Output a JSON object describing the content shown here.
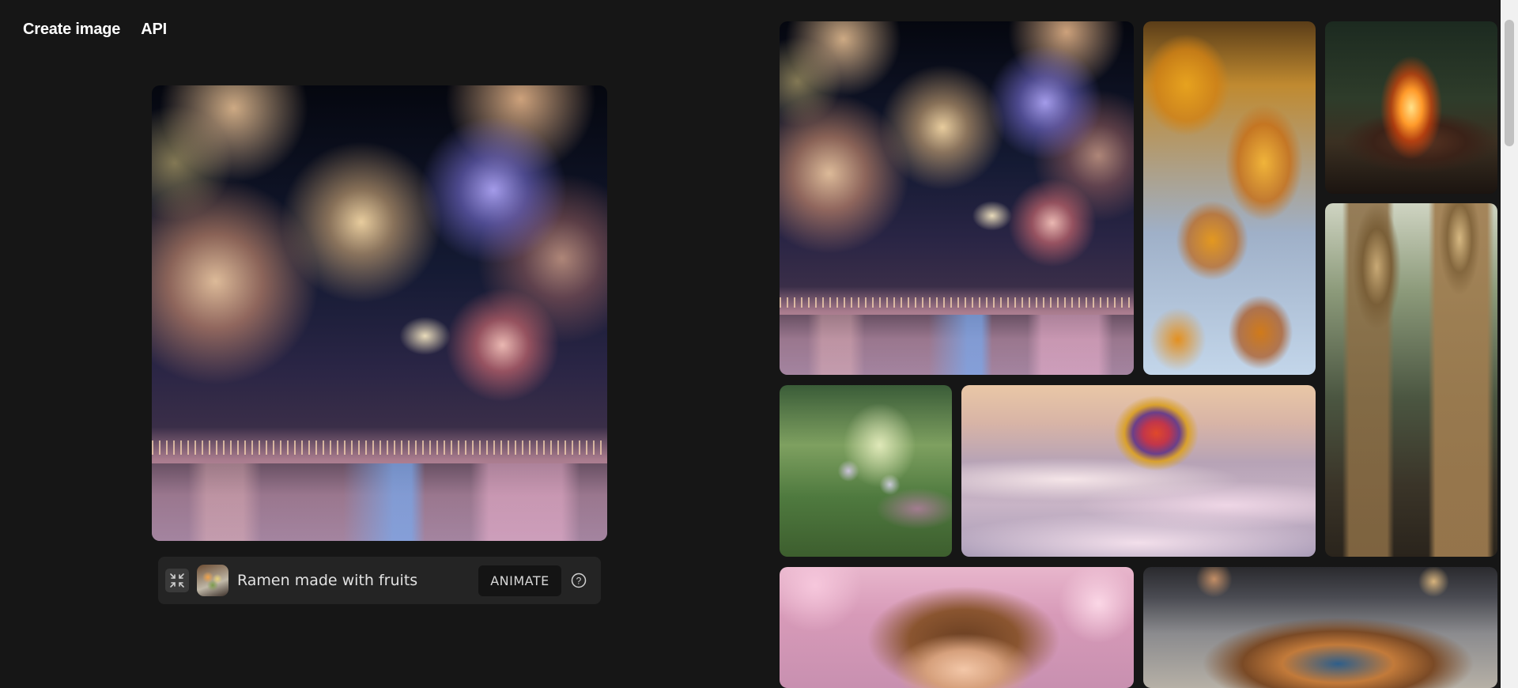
{
  "nav": {
    "create_label": "Create image",
    "api_label": "API"
  },
  "main_image": {
    "subject": "fireworks over harbor"
  },
  "prompt_bar": {
    "prompt": "Ramen made with fruits",
    "animate_label": "ANIMATE",
    "help_symbol": "?"
  },
  "gallery": [
    {
      "subject": "fireworks over harbor"
    },
    {
      "subject": "autumn maple leaves"
    },
    {
      "subject": "campfire in forest"
    },
    {
      "subject": "robots walking on road"
    },
    {
      "subject": "fairies in enchanted forest"
    },
    {
      "subject": "hot air balloon above clouds"
    },
    {
      "subject": "girl among cherry blossoms"
    },
    {
      "subject": "blue and orange dragon on street"
    }
  ],
  "icons": {
    "shrink": "collapse-icon",
    "help": "help-circle-icon"
  },
  "colors": {
    "background": "#161616",
    "prompt_bar": "#242424",
    "animate_button": "#141414"
  }
}
